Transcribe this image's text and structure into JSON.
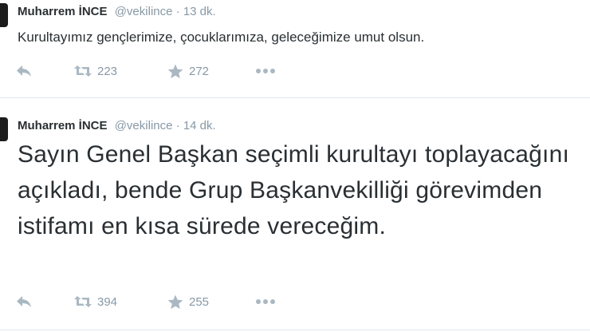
{
  "tweets": [
    {
      "fullname": "Muharrem İNCE",
      "username": "@vekilince",
      "separator": "·",
      "time": "13 dk.",
      "text": "Kurultayımız gençlerimize, çocuklarımıza, geleceğimize umut olsun.",
      "retweet_count": "223",
      "favorite_count": "272"
    },
    {
      "fullname": "Muharrem İNCE",
      "username": "@vekilince",
      "separator": "·",
      "time": "14 dk.",
      "text": "Sayın Genel Başkan seçimli kurultayı toplayacağını açıkladı, bende Grup Başkanvekilliği görevimden istifamı en kısa sürede vereceğim.",
      "retweet_count": "394",
      "favorite_count": "255"
    }
  ],
  "icons": {
    "reply": "reply-icon",
    "retweet": "retweet-icon",
    "favorite": "star-icon",
    "more": "more-icon"
  },
  "colors": {
    "text": "#292f33",
    "muted": "#8899a6",
    "icon": "#aab8c2",
    "divider": "#e1e8ed"
  }
}
